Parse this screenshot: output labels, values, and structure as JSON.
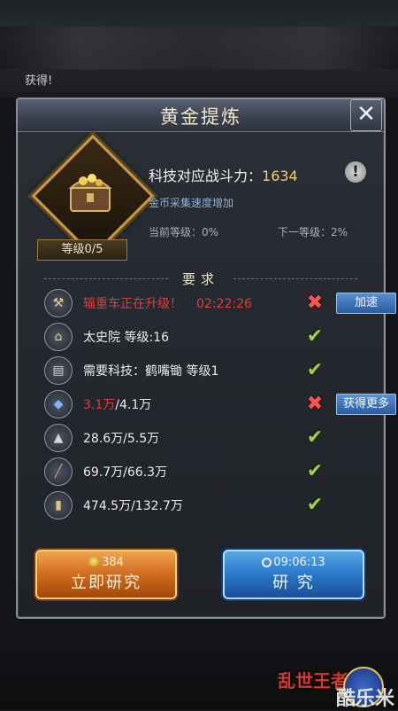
{
  "background": {
    "obtained_label": "获得!"
  },
  "dialog": {
    "title": "黄金提炼",
    "emblem": {
      "level_label": "等级0/5"
    },
    "info": {
      "power_label": "科技对应战斗力：",
      "power_value": "1634",
      "description": "金币采集速度增加",
      "current_level": "当前等级：0%",
      "next_level": "下一等级：2%"
    },
    "requirements_title": "要求",
    "requirements": [
      {
        "icon": "ram-icon",
        "text": "辐重车正在升级！",
        "time": "02:22:26",
        "met": false,
        "action": "加速"
      },
      {
        "icon": "academy-icon",
        "text": "太史院  等级:16",
        "met": true
      },
      {
        "icon": "scroll-icon",
        "text": "需要科技：鹤嘴锄  等级1",
        "met": true
      },
      {
        "icon": "crystal-icon",
        "have": "3.1万",
        "need": "/4.1万",
        "met": false,
        "action": "获得更多"
      },
      {
        "icon": "ore-icon",
        "text": "28.6万/5.5万",
        "met": true
      },
      {
        "icon": "wood-icon",
        "text": "69.7万/66.3万",
        "met": true
      },
      {
        "icon": "grain-icon",
        "text": "474.5万/132.7万",
        "met": true
      }
    ],
    "buttons": {
      "instant": {
        "cost": "384",
        "label": "立即研究"
      },
      "research": {
        "time": "09:06:13",
        "label": "研    究"
      }
    }
  },
  "branding": {
    "game_logo": "乱世王者",
    "watermark": "酷乐米"
  },
  "colors": {
    "accent_gold": "#f2ce6a",
    "error_red": "#e23b3b",
    "ok_green": "#9fd24a",
    "button_blue": "#2a77c9",
    "button_orange": "#cf6c1e"
  }
}
